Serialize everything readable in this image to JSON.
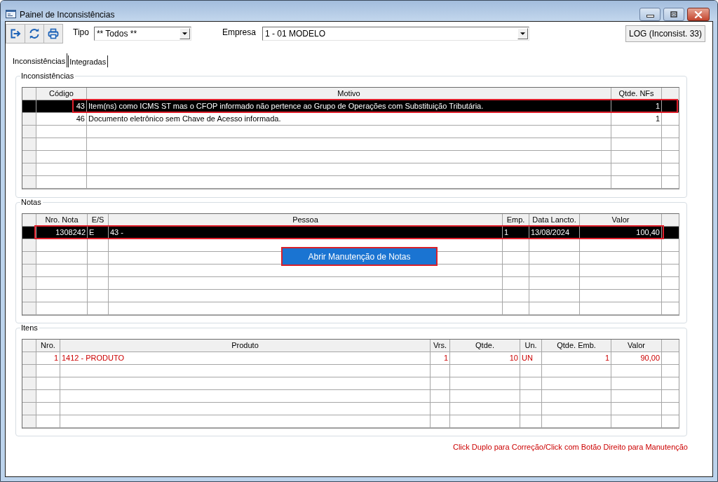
{
  "window": {
    "title": "Painel de Inconsistências"
  },
  "filters": [
    {
      "label": "Tipo",
      "value": "** Todos **"
    },
    {
      "label": "Empresa",
      "value": "1 - 01 MODELO"
    }
  ],
  "log_button": {
    "label": "LOG (Inconsist. 33)"
  },
  "tabs": [
    {
      "label": "Inconsistências",
      "selected": true
    },
    {
      "label": "Integradas",
      "selected": false
    }
  ],
  "inconsistencias": {
    "title": "Inconsistências",
    "columns": [
      "Código",
      "Motivo",
      "Qtde. NFs"
    ],
    "rows": [
      {
        "cells": [
          "43",
          "Item(ns) como ICMS ST mas o CFOP informado não pertence ao Grupo de Operações com Substituição Tributária.",
          "1"
        ],
        "selected": true,
        "outlined": true
      },
      {
        "cells": [
          "46",
          "Documento eletrônico sem Chave de Acesso informada.",
          "1"
        ],
        "selected": false,
        "outlined": false
      }
    ]
  },
  "notas": {
    "title": "Notas",
    "columns": [
      "Nro. Nota",
      "E/S",
      "Pessoa",
      "Emp.",
      "Data Lancto.",
      "Valor"
    ],
    "rows": [
      {
        "cells": [
          "1308242",
          "E",
          "43 -",
          "1",
          "13/08/2024",
          "100,40"
        ],
        "selected": true,
        "outlined": true
      }
    ],
    "context_menu": {
      "items": [
        {
          "label": "Abrir Manutenção de Notas",
          "selected": true,
          "outlined": true
        }
      ]
    }
  },
  "itens": {
    "title": "Itens",
    "columns": [
      "Nro.",
      "Produto",
      "Vrs.",
      "Qtde.",
      "Un.",
      "Qtde. Emb.",
      "Valor"
    ],
    "rows": [
      {
        "cells": [
          "1",
          "1412 - PRODUTO",
          "1",
          "10",
          "UN",
          "1",
          "90,00"
        ],
        "selected": false,
        "outlined": false,
        "color": "#cc0000"
      }
    ]
  },
  "footer": {
    "hint": "Click Duplo para Correção/Click com Botão Direito para Manutenção"
  }
}
